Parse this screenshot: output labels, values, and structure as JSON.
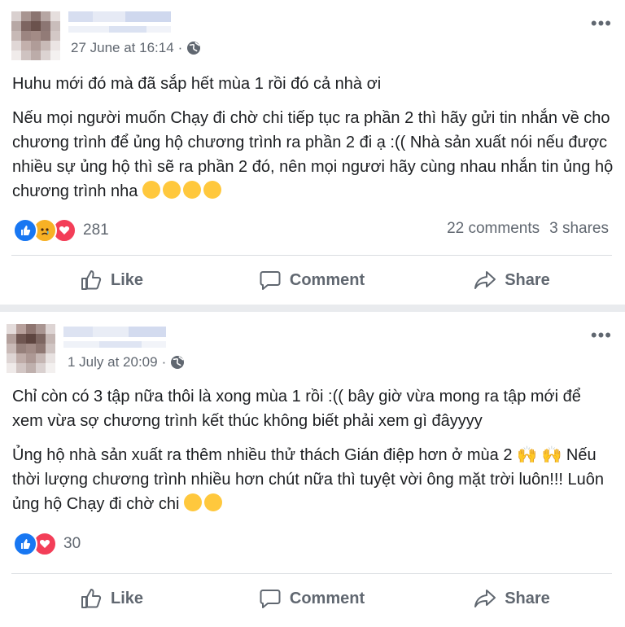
{
  "posts": [
    {
      "timestamp": "27 June at 16:14",
      "privacy_icon": "globe-icon",
      "paragraphs": [
        "Huhu mới đó mà đã sắp hết mùa 1 rồi đó cả nhà ơi",
        "Nếu mọi người muốn Chạy đi chờ chi tiếp tục ra phần 2 thì hãy gửi tin nhắn về cho chương trình để ủng hộ chương trình ra phần 2 đi ạ :(( Nhà sản xuất nói nếu được nhiều sự ủng hộ thì sẽ ra phần 2 đó, nên mọi ngươi hãy cùng nhau nhắn tin ủng hộ chương trình nha"
      ],
      "reactions": [
        "like",
        "sad",
        "love"
      ],
      "reaction_count": "281",
      "comments": "22 comments",
      "shares": "3 shares",
      "actions": {
        "like": "Like",
        "comment": "Comment",
        "share": "Share"
      }
    },
    {
      "timestamp": "1 July at 20:09",
      "privacy_icon": "globe-icon",
      "paragraphs": [
        "Chỉ còn có 3 tập nữa thôi là xong mùa 1 rồi :(( bây giờ vừa mong ra tập mới để xem vừa sợ chương trình kết thúc không biết phải xem gì đâyyyy",
        "Ủng hộ nhà sản xuất ra thêm nhiều thử thách Gián điệp hơn ở mùa 2 🙌 🙌 Nếu thời lượng chương trình nhiều hơn chút nữa thì tuyệt vời ông mặt trời luôn!!! Luôn ủng hộ Chạy đi chờ chi"
      ],
      "reactions": [
        "like",
        "love"
      ],
      "reaction_count": "30",
      "actions": {
        "like": "Like",
        "comment": "Comment",
        "share": "Share"
      }
    }
  ],
  "colors": {
    "like_blue": "#1877f2",
    "love_red": "#f33e58",
    "sad_yellow": "#f7b125",
    "meta_gray": "#606770",
    "divider": "#dadde1"
  }
}
